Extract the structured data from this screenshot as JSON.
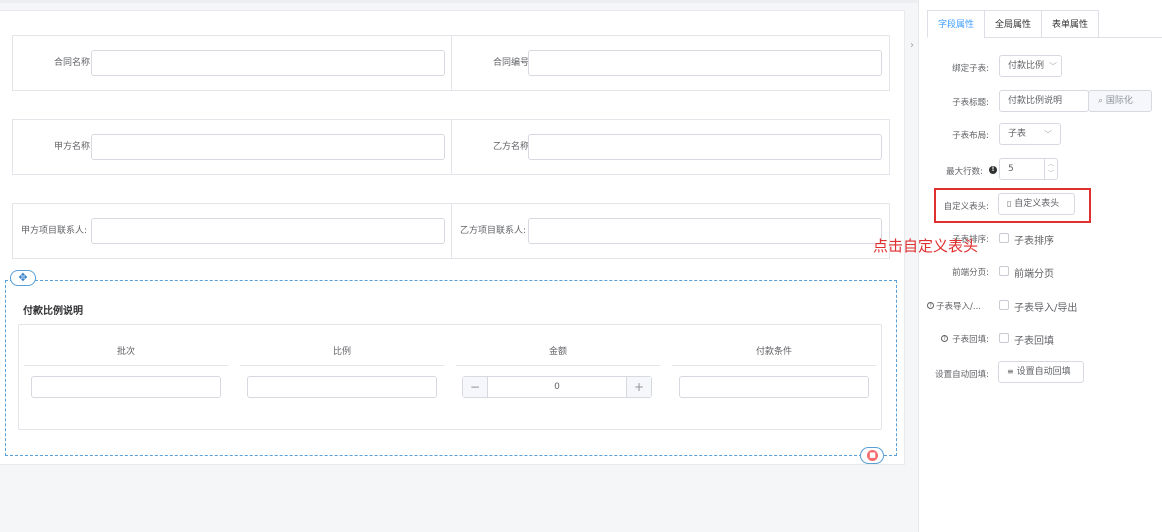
{
  "form": {
    "rows": [
      {
        "left_label": "合同名称:",
        "right_label": "合同编号:"
      },
      {
        "left_label": "甲方名称:",
        "right_label": "乙方名称:"
      },
      {
        "left_label": "甲方项目联系人:",
        "right_label": "乙方项目联系人:"
      }
    ]
  },
  "subtable": {
    "title": "付款比例说明",
    "columns": [
      "批次",
      "比例",
      "金额",
      "付款条件"
    ],
    "amount_value": "0",
    "minus_label": "−",
    "plus_label": "+"
  },
  "panel": {
    "tabs": [
      {
        "label": "字段属性",
        "active": true
      },
      {
        "label": "全局属性",
        "active": false
      },
      {
        "label": "表单属性",
        "active": false
      }
    ],
    "bind_subtable": {
      "label": "绑定子表:",
      "value": "付款比例"
    },
    "subtable_title": {
      "label": "子表标题:",
      "value": "付款比例说明",
      "i18n_button": "国际化"
    },
    "subtable_layout": {
      "label": "子表布局:",
      "value": "子表"
    },
    "max_rows": {
      "label": "最大行数:",
      "value": "5"
    },
    "custom_header": {
      "label": "自定义表头:",
      "button": "自定义表头"
    },
    "subtable_sort": {
      "label": "子表排序:",
      "checkbox_label": "子表排序"
    },
    "frontend_paging": {
      "label": "前端分页:",
      "checkbox_label": "前端分页"
    },
    "import_export": {
      "label": "子表导入/...",
      "checkbox_label": "子表导入/导出"
    },
    "backfill": {
      "label": "子表回填:",
      "checkbox_label": "子表回填"
    },
    "auto_backfill": {
      "label": "设置自动回填:",
      "button": "设置自动回填"
    }
  },
  "annotation": {
    "text": "点击自定义表头",
    "color": "#e02f2f"
  },
  "colors": {
    "accent": "#409eff",
    "highlight": "#e02f2f",
    "dashed_border": "#5a9fd6"
  }
}
